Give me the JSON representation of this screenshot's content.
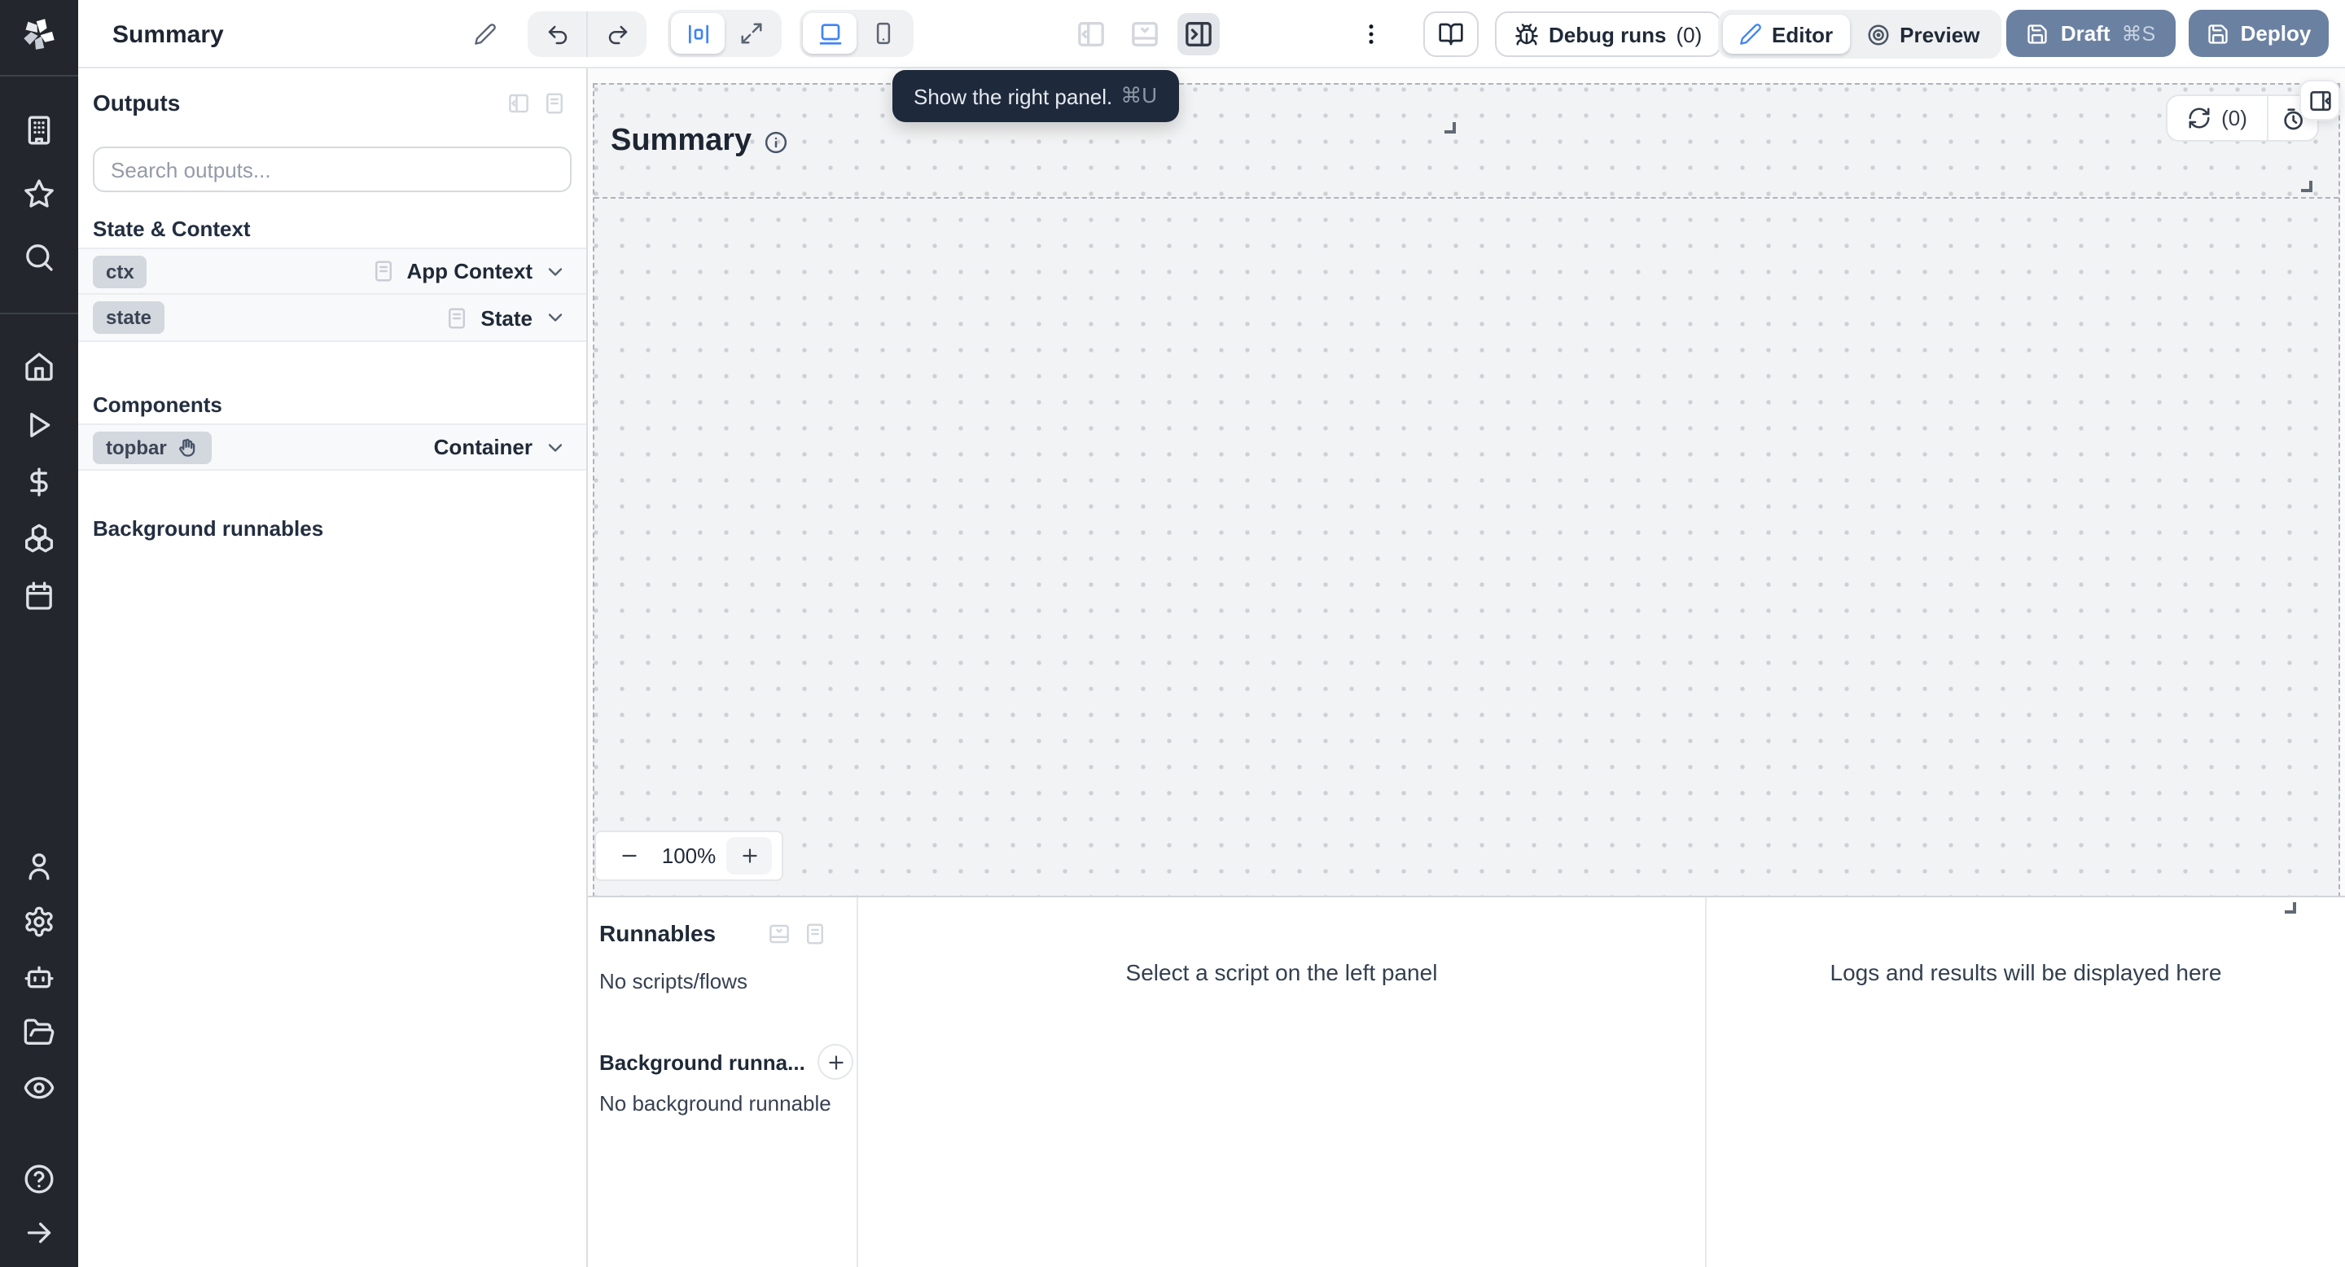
{
  "window": {
    "title": "Summary"
  },
  "colors": {
    "accent_blue": "#3f83f8",
    "primary_button": "#6b81a2",
    "tooltip_bg": "#1e293b",
    "rail_bg": "#23262c",
    "canvas_bg": "#f2f3f4"
  },
  "toolbar": {
    "title": "Summary",
    "kebab": "⋮",
    "debug_runs_label": "Debug runs",
    "debug_runs_count": "(0)",
    "editor_label": "Editor",
    "preview_label": "Preview",
    "draft_label": "Draft",
    "draft_shortcut": "⌘S",
    "deploy_label": "Deploy"
  },
  "tooltip": {
    "text": "Show the right panel.",
    "shortcut": "⌘U"
  },
  "rail": {
    "icons_top": [
      "building",
      "star",
      "search"
    ],
    "icons_middle": [
      "home",
      "play",
      "dollar",
      "boxes",
      "calendar"
    ],
    "icons_bottom": [
      "user",
      "settings",
      "bot",
      "folder-open",
      "eye",
      "help",
      "arrow-right"
    ]
  },
  "outputs_panel": {
    "title": "Outputs",
    "search_placeholder": "Search outputs...",
    "section_state_context": "State & Context",
    "section_components": "Components",
    "section_background": "Background runnables",
    "rows": {
      "ctx": {
        "badge": "ctx",
        "type": "App Context"
      },
      "state": {
        "badge": "state",
        "type": "State"
      },
      "topbar": {
        "badge": "topbar",
        "type": "Container"
      }
    }
  },
  "canvas": {
    "component_title": "Summary",
    "refresh_count": "(0)",
    "zoom_minus": "−",
    "zoom_level": "100%",
    "zoom_plus": "+"
  },
  "runnables_panel": {
    "title": "Runnables",
    "empty_scripts": "No scripts/flows",
    "background_title": "Background runna...",
    "empty_background": "No background runnable",
    "middle_placeholder": "Select a script on the left panel",
    "right_placeholder": "Logs and results will be displayed here"
  }
}
